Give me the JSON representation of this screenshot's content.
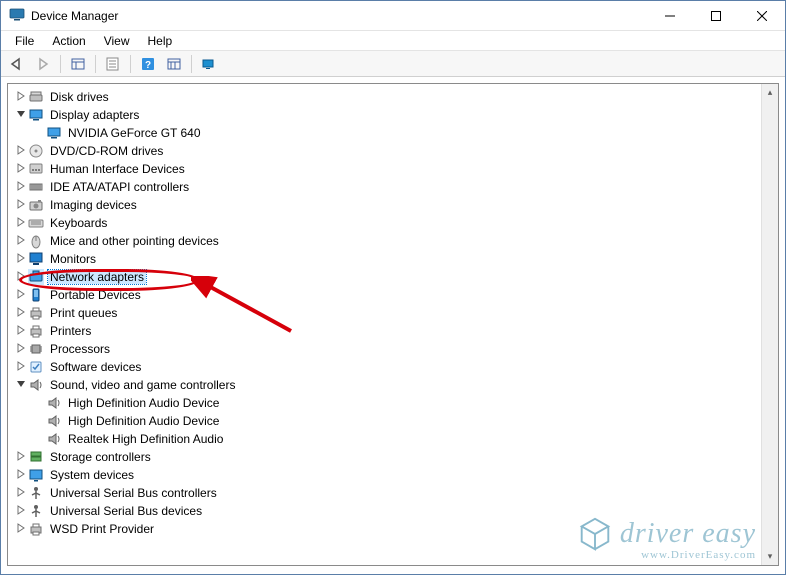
{
  "window": {
    "title": "Device Manager"
  },
  "menu": {
    "file": "File",
    "action": "Action",
    "view": "View",
    "help": "Help"
  },
  "toolbar_icons": {
    "back": "back-arrow",
    "forward": "forward-arrow",
    "show_hidden": "show-hidden",
    "properties": "properties",
    "help": "help",
    "details": "details",
    "pc": "pc"
  },
  "tree": [
    {
      "label": "Disk drives",
      "expanded": false,
      "depth": 0,
      "icon": "disk"
    },
    {
      "label": "Display adapters",
      "expanded": true,
      "depth": 0,
      "icon": "monitor-tiny"
    },
    {
      "label": "NVIDIA GeForce GT 640",
      "expanded": null,
      "depth": 1,
      "icon": "monitor-tiny"
    },
    {
      "label": "DVD/CD-ROM drives",
      "expanded": false,
      "depth": 0,
      "icon": "cdrom"
    },
    {
      "label": "Human Interface Devices",
      "expanded": false,
      "depth": 0,
      "icon": "hid"
    },
    {
      "label": "IDE ATA/ATAPI controllers",
      "expanded": false,
      "depth": 0,
      "icon": "ide"
    },
    {
      "label": "Imaging devices",
      "expanded": false,
      "depth": 0,
      "icon": "camera"
    },
    {
      "label": "Keyboards",
      "expanded": false,
      "depth": 0,
      "icon": "keyboard"
    },
    {
      "label": "Mice and other pointing devices",
      "expanded": false,
      "depth": 0,
      "icon": "mouse"
    },
    {
      "label": "Monitors",
      "expanded": false,
      "depth": 0,
      "icon": "monitor"
    },
    {
      "label": "Network adapters",
      "expanded": false,
      "depth": 0,
      "icon": "network",
      "highlighted": true
    },
    {
      "label": "Portable Devices",
      "expanded": false,
      "depth": 0,
      "icon": "portable"
    },
    {
      "label": "Print queues",
      "expanded": false,
      "depth": 0,
      "icon": "printer"
    },
    {
      "label": "Printers",
      "expanded": false,
      "depth": 0,
      "icon": "printer"
    },
    {
      "label": "Processors",
      "expanded": false,
      "depth": 0,
      "icon": "cpu"
    },
    {
      "label": "Software devices",
      "expanded": false,
      "depth": 0,
      "icon": "software"
    },
    {
      "label": "Sound, video and game controllers",
      "expanded": true,
      "depth": 0,
      "icon": "speaker"
    },
    {
      "label": "High Definition Audio Device",
      "expanded": null,
      "depth": 1,
      "icon": "speaker"
    },
    {
      "label": "High Definition Audio Device",
      "expanded": null,
      "depth": 1,
      "icon": "speaker"
    },
    {
      "label": "Realtek High Definition Audio",
      "expanded": null,
      "depth": 1,
      "icon": "speaker"
    },
    {
      "label": "Storage controllers",
      "expanded": false,
      "depth": 0,
      "icon": "storage"
    },
    {
      "label": "System devices",
      "expanded": false,
      "depth": 0,
      "icon": "system"
    },
    {
      "label": "Universal Serial Bus controllers",
      "expanded": false,
      "depth": 0,
      "icon": "usb"
    },
    {
      "label": "Universal Serial Bus devices",
      "expanded": false,
      "depth": 0,
      "icon": "usb"
    },
    {
      "label": "WSD Print Provider",
      "expanded": false,
      "depth": 0,
      "icon": "printer"
    }
  ],
  "watermark": {
    "brand": "driver easy",
    "url": "www.DriverEasy.com"
  },
  "annotations": {
    "circle_target": "Network adapters",
    "arrow_target": "Network adapters"
  }
}
